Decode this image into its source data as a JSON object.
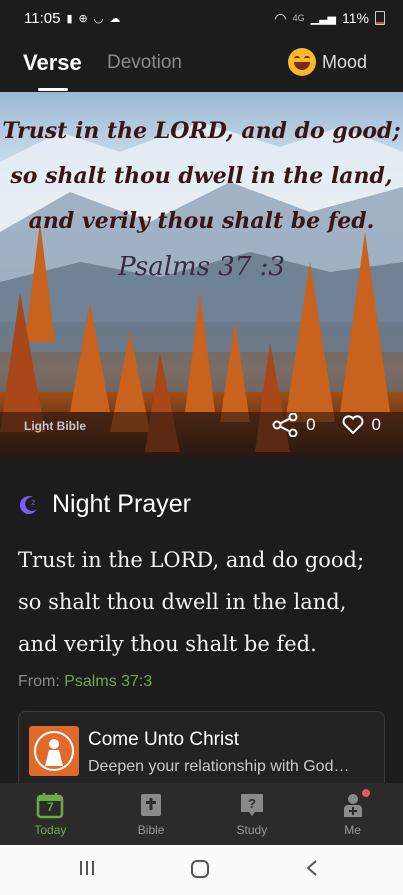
{
  "status": {
    "time": "11:05",
    "network": "4G",
    "battery": "11%"
  },
  "tabs": {
    "verse": "Verse",
    "devotion": "Devotion",
    "mood": "Mood"
  },
  "hero": {
    "verse_lines": [
      "Trust in the LORD, and do good;",
      "so shalt thou dwell in the land,",
      "and verily thou shalt be fed."
    ],
    "reference": "Psalms 37 :3",
    "watermark": "Light Bible",
    "share_count": "0",
    "like_count": "0"
  },
  "prayer": {
    "heading": "Night Prayer",
    "text": "Trust in the LORD, and do good; so shalt thou dwell in the land, and verily thou shalt be fed.",
    "from_label": "From:",
    "from_ref": "Psalms 37:3"
  },
  "card": {
    "title": "Come Unto Christ",
    "subtitle": "Deepen your relationship with God…"
  },
  "nav": {
    "today_day": "7",
    "today": "Today",
    "bible": "Bible",
    "study": "Study",
    "me": "Me"
  },
  "colors": {
    "accent_green": "#6eaa4a",
    "moon_purple": "#7a5cff",
    "badge_red": "#e05a5a"
  }
}
